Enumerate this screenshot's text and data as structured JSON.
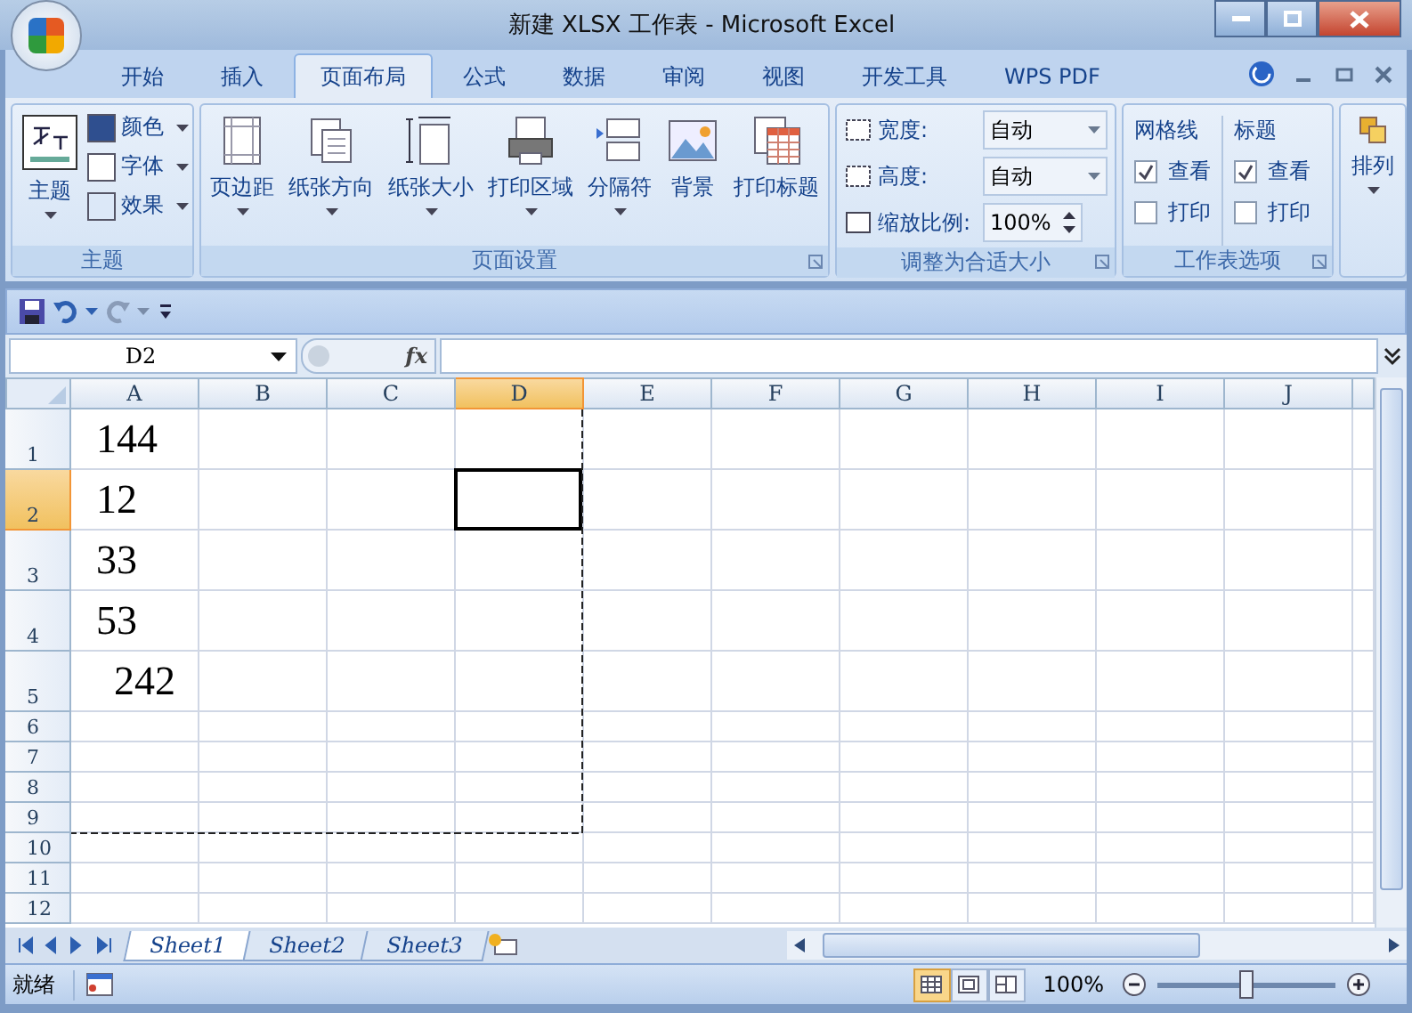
{
  "window": {
    "title": "新建 XLSX 工作表 - Microsoft Excel"
  },
  "ribbon_tabs": [
    {
      "label": "开始",
      "selected": false
    },
    {
      "label": "插入",
      "selected": false
    },
    {
      "label": "页面布局",
      "selected": true
    },
    {
      "label": "公式",
      "selected": false
    },
    {
      "label": "数据",
      "selected": false
    },
    {
      "label": "审阅",
      "selected": false
    },
    {
      "label": "视图",
      "selected": false
    },
    {
      "label": "开发工具",
      "selected": false
    },
    {
      "label": "WPS PDF",
      "selected": false
    }
  ],
  "theme_group": {
    "title": "主题",
    "button": "主题",
    "options": [
      "颜色",
      "字体",
      "效果"
    ]
  },
  "page_setup_group": {
    "title": "页面设置",
    "buttons": [
      {
        "label": "页边距",
        "dropdown": true
      },
      {
        "label": "纸张方向",
        "dropdown": true
      },
      {
        "label": "纸张大小",
        "dropdown": true
      },
      {
        "label": "打印区域",
        "dropdown": true
      },
      {
        "label": "分隔符",
        "dropdown": true
      },
      {
        "label": "背景",
        "dropdown": false
      },
      {
        "label": "打印标题",
        "dropdown": false
      }
    ]
  },
  "scale_group": {
    "title": "调整为合适大小",
    "fields": [
      {
        "label": "宽度:",
        "value": "自动",
        "kind": "dropdown"
      },
      {
        "label": "高度:",
        "value": "自动",
        "kind": "dropdown"
      },
      {
        "label": "缩放比例:",
        "value": "100%",
        "kind": "spinner"
      }
    ]
  },
  "sheet_options_group": {
    "title": "工作表选项",
    "sections": [
      {
        "heading": "网格线",
        "options": [
          {
            "label": "查看",
            "checked": true
          },
          {
            "label": "打印",
            "checked": false
          }
        ]
      },
      {
        "heading": "标题",
        "options": [
          {
            "label": "查看",
            "checked": true
          },
          {
            "label": "打印",
            "checked": false
          }
        ]
      }
    ]
  },
  "arrange_group": {
    "button": "排列"
  },
  "name_box": "D2",
  "formula_label": "fx",
  "columns": [
    {
      "label": "A",
      "selected": false
    },
    {
      "label": "B",
      "selected": false
    },
    {
      "label": "C",
      "selected": false
    },
    {
      "label": "D",
      "selected": true
    },
    {
      "label": "E",
      "selected": false
    },
    {
      "label": "F",
      "selected": false
    },
    {
      "label": "G",
      "selected": false
    },
    {
      "label": "H",
      "selected": false
    },
    {
      "label": "I",
      "selected": false
    },
    {
      "label": "J",
      "selected": false
    }
  ],
  "rows": [
    {
      "number": "1",
      "selected": false,
      "cells": [
        "144"
      ]
    },
    {
      "number": "2",
      "selected": true,
      "cells": [
        "12"
      ]
    },
    {
      "number": "3",
      "selected": false,
      "cells": [
        "33"
      ]
    },
    {
      "number": "4",
      "selected": false,
      "cells": [
        "53"
      ]
    },
    {
      "number": "5",
      "selected": false,
      "cells": [
        "242"
      ]
    },
    {
      "number": "6",
      "selected": false,
      "cells": []
    },
    {
      "number": "7",
      "selected": false,
      "cells": []
    },
    {
      "number": "8",
      "selected": false,
      "cells": []
    },
    {
      "number": "9",
      "selected": false,
      "cells": []
    },
    {
      "number": "10",
      "selected": false,
      "cells": []
    },
    {
      "number": "11",
      "selected": false,
      "cells": []
    },
    {
      "number": "12",
      "selected": false,
      "cells": []
    }
  ],
  "sheet_tabs": [
    {
      "label": "Sheet1",
      "selected": true
    },
    {
      "label": "Sheet2",
      "selected": false
    },
    {
      "label": "Sheet3",
      "selected": false
    }
  ],
  "status_bar": {
    "status": "就绪",
    "views": [
      {
        "selected": true
      },
      {
        "selected": false
      },
      {
        "selected": false
      }
    ],
    "zoom": "100%",
    "zoom_slider": {
      "level": 0.5
    }
  }
}
